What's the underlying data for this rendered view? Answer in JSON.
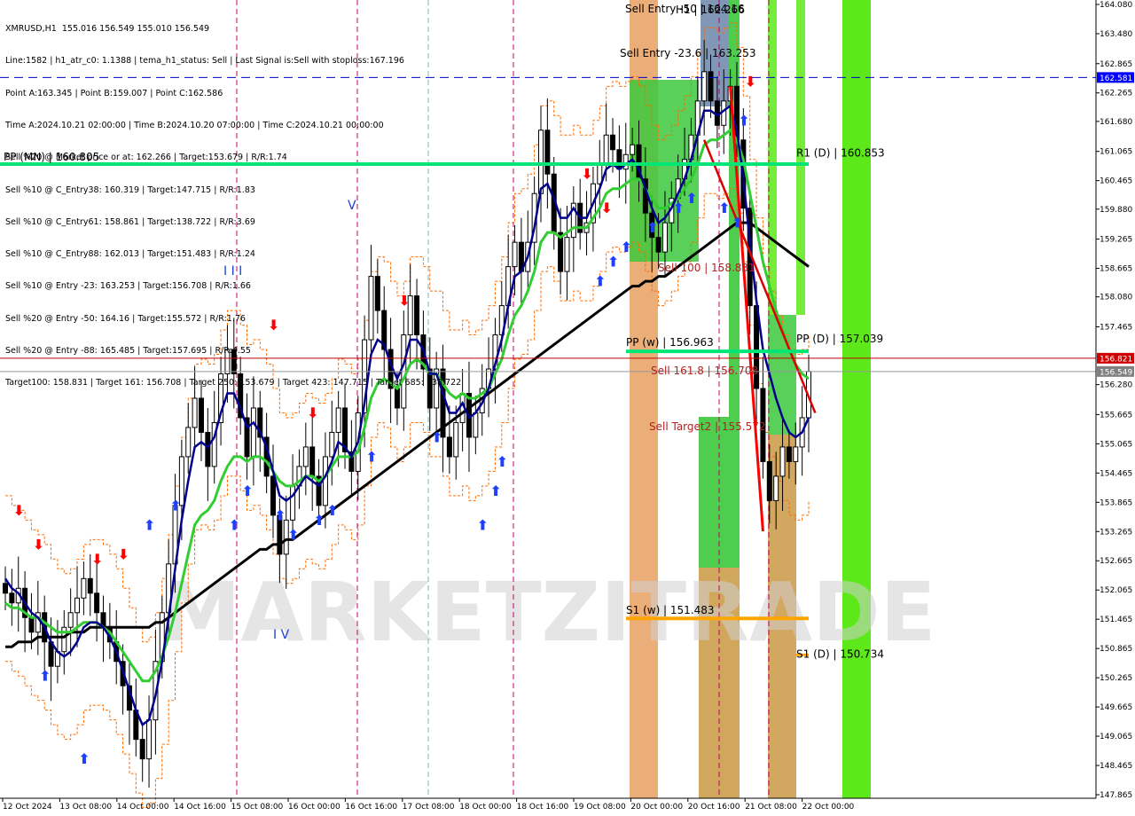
{
  "header": {
    "lines": [
      "XMRUSD,H1  155.016 156.549 155.010 156.549",
      "Line:1582 | h1_atr_c0: 1.1388 | tema_h1_status: Sell | Last Signal is:Sell with stoploss:167.196",
      "Point A:163.345 | Point B:159.007 | Point C:162.586",
      "Time A:2024.10.21 02:00:00 | Time B:2024.10.20 07:00:00 | Time C:2024.10.21 00:00:00",
      "Sell %20 @ Market price or at: 162.266 | Target:153.679 | R/R:1.74",
      "Sell %10 @ C_Entry38: 160.319 | Target:147.715 | R/R:1.83",
      "Sell %10 @ C_Entry61: 158.861 | Target:138.722 | R/R:3.69",
      "Sell %10 @ C_Entry88: 162.013 | Target:151.483 | R/R:1.24",
      "Sell %10 @ Entry -23: 163.253 | Target:156.708 | R/R:1.66",
      "Sell %20 @ Entry -50: 164.16 | Target:155.572 | R/R:1.76",
      "Sell %20 @ Entry -88: 165.485 | Target:157.695 | R/R:4.55",
      "Target100: 158.831 | Target 161: 156.708 | Target 250: 153.679 | Target 423: 147.715 | Target 685: 138.722"
    ]
  },
  "watermark": "MARKETZITRADE",
  "colors": {
    "candle": "#000000",
    "ema_blue": "#00008b",
    "ema_green": "#32cd32",
    "ma_black": "#000000",
    "orange_dash": "#ff6a00",
    "pivot_green": "#00e676",
    "price_red": "#c00000",
    "s1_orange": "#ffa500",
    "band_bright_green": "#5de81a",
    "band_green": "#3cc83c",
    "band_orange": "#e8a060",
    "band_steelblue": "#6a86a8",
    "up_arrow": "#1f3fff",
    "down_arrow": "#ff0000"
  },
  "chart_data": {
    "type": "candlestick",
    "symbol": "XMRUSD",
    "timeframe": "H1",
    "ohlc_last": {
      "open": 155.016,
      "high": 156.549,
      "low": 155.01,
      "close": 156.549
    },
    "ylim": [
      147.865,
      164.08
    ],
    "y_ticks": [
      "164.080",
      "163.480",
      "162.865",
      "162.265",
      "161.680",
      "161.065",
      "160.465",
      "159.880",
      "159.265",
      "158.665",
      "158.080",
      "157.465",
      "156.280",
      "155.665",
      "155.065",
      "154.465",
      "153.865",
      "153.265",
      "152.665",
      "152.065",
      "151.465",
      "150.865",
      "150.265",
      "149.665",
      "149.065",
      "148.465",
      "147.865"
    ],
    "x_ticks": [
      "12 Oct 2024",
      "13 Oct 08:00",
      "14 Oct 00:00",
      "14 Oct 16:00",
      "15 Oct 08:00",
      "16 Oct 00:00",
      "16 Oct 16:00",
      "17 Oct 08:00",
      "18 Oct 00:00",
      "18 Oct 16:00",
      "19 Oct 08:00",
      "20 Oct 00:00",
      "20 Oct 16:00",
      "21 Oct 08:00",
      "22 Oct 00:00"
    ],
    "price_badges": [
      {
        "value": "162.581",
        "bg": "#0000ff",
        "color": "#ffffff"
      },
      {
        "value": "156.821",
        "bg": "#d00000",
        "color": "#ffffff"
      },
      {
        "value": "156.549",
        "bg": "#808080",
        "color": "#ffffff"
      }
    ],
    "levels": [
      {
        "label": "PP (MN) | 160.805",
        "price": 160.805,
        "color": "#00e676"
      },
      {
        "label": "R1 (D) | 160.853",
        "price": 160.853
      },
      {
        "label": "PP (w) | 156.963",
        "price": 156.963,
        "color": "#00e676"
      },
      {
        "label": "PP (D) | 157.039",
        "price": 157.039
      },
      {
        "label": "S1 (w) | 151.483",
        "price": 151.483,
        "color": "#ffa500"
      },
      {
        "label": "S1 (D) | 150.734",
        "price": 150.734,
        "color": "#ffa500"
      },
      {
        "label": "Sell Entry -50 | 164.16",
        "price": 164.16
      },
      {
        "label": "Sell Entry -23.6 | 163.253",
        "price": 163.253
      },
      {
        "label": "Sell 100 | 158.831",
        "price": 158.831
      },
      {
        "label": "Sell 161.8 | 156.708",
        "price": 156.708
      },
      {
        "label": "Sell Target2 | 155.572",
        "price": 155.572
      },
      {
        "label": "H1 | 162.266",
        "price": 162.266
      }
    ],
    "wave_labels": [
      {
        "text": "I I I"
      },
      {
        "text": "V"
      },
      {
        "text": "I V"
      }
    ],
    "closes": [
      152.0,
      151.8,
      152.1,
      151.5,
      151.2,
      151.6,
      151.0,
      150.5,
      150.8,
      151.3,
      151.6,
      151.9,
      152.3,
      152.0,
      151.6,
      151.3,
      151.0,
      150.6,
      150.1,
      149.6,
      149.0,
      148.6,
      149.4,
      150.6,
      151.6,
      152.6,
      153.8,
      154.8,
      155.4,
      156.0,
      155.3,
      154.6,
      155.5,
      156.5,
      157.0,
      156.5,
      155.6,
      154.8,
      155.8,
      155.2,
      154.4,
      153.6,
      152.8,
      153.5,
      154.2,
      154.6,
      155.0,
      154.4,
      153.8,
      154.8,
      155.3,
      155.8,
      154.9,
      154.5,
      155.7,
      157.2,
      158.5,
      157.8,
      157.0,
      156.2,
      155.8,
      157.3,
      158.1,
      157.3,
      156.6,
      155.8,
      156.6,
      155.2,
      154.8,
      155.5,
      156.1,
      155.2,
      155.7,
      156.2,
      156.6,
      157.3,
      157.9,
      158.7,
      159.2,
      158.6,
      159.2,
      160.2,
      161.5,
      160.6,
      159.4,
      158.6,
      159.3,
      160.0,
      159.4,
      159.6,
      160.4,
      160.8,
      161.4,
      161.1,
      160.7,
      161.0,
      161.2,
      160.5,
      159.8,
      159.3,
      159.0,
      159.6,
      160.1,
      160.5,
      160.9,
      161.4,
      162.1,
      162.7,
      162.1,
      161.6,
      162.1,
      162.4,
      161.3,
      159.9,
      157.9,
      156.2,
      154.7,
      153.9,
      154.4,
      155.0,
      154.7,
      155.0,
      155.6,
      156.549
    ],
    "ema_blue": [
      152.3,
      152.1,
      152.0,
      151.8,
      151.6,
      151.5,
      151.3,
      151.0,
      150.8,
      150.7,
      150.8,
      151.0,
      151.3,
      151.4,
      151.4,
      151.3,
      151.1,
      150.8,
      150.4,
      150.0,
      149.6,
      149.3,
      149.4,
      149.9,
      150.6,
      151.5,
      152.5,
      153.5,
      154.3,
      155.0,
      155.1,
      155.0,
      155.2,
      155.7,
      156.1,
      156.1,
      155.8,
      155.4,
      155.5,
      155.3,
      155.0,
      154.5,
      154.0,
      153.9,
      154.0,
      154.2,
      154.4,
      154.3,
      154.2,
      154.4,
      154.7,
      155.1,
      155.0,
      154.8,
      155.1,
      155.9,
      156.9,
      157.2,
      157.1,
      156.7,
      156.4,
      156.7,
      157.2,
      157.2,
      157.0,
      156.5,
      156.5,
      156.1,
      155.7,
      155.7,
      155.9,
      155.6,
      155.7,
      155.9,
      156.2,
      156.7,
      157.2,
      157.9,
      158.5,
      158.6,
      158.9,
      159.5,
      160.3,
      160.4,
      160.1,
      159.7,
      159.7,
      159.9,
      159.7,
      159.7,
      160.0,
      160.3,
      160.7,
      160.8,
      160.7,
      160.8,
      160.9,
      160.7,
      160.3,
      159.9,
      159.6,
      159.7,
      159.9,
      160.2,
      160.5,
      160.9,
      161.4,
      161.9,
      161.9,
      161.8,
      161.9,
      162.0,
      161.5,
      160.5,
      159.2,
      158.0,
      157.0,
      156.5,
      156.0,
      155.6,
      155.3,
      155.2,
      155.3,
      155.6
    ],
    "ema_green": [
      151.8,
      151.7,
      151.7,
      151.6,
      151.5,
      151.5,
      151.4,
      151.3,
      151.2,
      151.2,
      151.2,
      151.3,
      151.4,
      151.4,
      151.4,
      151.3,
      151.2,
      151.0,
      150.8,
      150.6,
      150.4,
      150.2,
      150.2,
      150.4,
      150.7,
      151.1,
      151.6,
      152.2,
      152.8,
      153.4,
      153.6,
      153.7,
      153.9,
      154.3,
      154.6,
      154.8,
      154.8,
      154.7,
      154.8,
      154.8,
      154.7,
      154.5,
      154.3,
      154.2,
      154.2,
      154.3,
      154.4,
      154.4,
      154.3,
      154.4,
      154.6,
      154.8,
      154.8,
      154.8,
      154.9,
      155.4,
      156.0,
      156.3,
      156.4,
      156.3,
      156.2,
      156.4,
      156.7,
      156.8,
      156.7,
      156.5,
      156.5,
      156.3,
      156.1,
      156.0,
      156.1,
      156.0,
      156.0,
      156.1,
      156.2,
      156.5,
      156.8,
      157.3,
      157.7,
      157.9,
      158.2,
      158.6,
      159.2,
      159.4,
      159.4,
      159.3,
      159.4,
      159.5,
      159.5,
      159.5,
      159.7,
      159.9,
      160.2,
      160.3,
      160.3,
      160.4,
      160.5,
      160.5,
      160.3,
      160.1,
      159.9,
      159.9,
      160.0,
      160.1,
      160.3,
      160.5,
      160.8,
      161.2,
      161.3,
      161.3,
      161.4,
      161.5,
      161.3,
      160.9,
      160.2,
      159.5,
      158.8,
      158.3,
      157.8,
      157.4,
      157.0,
      156.7,
      156.5,
      156.4
    ],
    "ma_black": [
      150.9,
      150.9,
      151.0,
      151.0,
      151.0,
      151.1,
      151.1,
      151.1,
      151.1,
      151.1,
      151.2,
      151.2,
      151.2,
      151.3,
      151.3,
      151.3,
      151.3,
      151.3,
      151.3,
      151.3,
      151.3,
      151.3,
      151.3,
      151.4,
      151.4,
      151.5,
      151.6,
      151.7,
      151.8,
      151.9,
      152.0,
      152.1,
      152.2,
      152.3,
      152.4,
      152.5,
      152.6,
      152.7,
      152.8,
      152.9,
      152.9,
      153.0,
      153.0,
      153.1,
      153.1,
      153.2,
      153.3,
      153.4,
      153.5,
      153.6,
      153.7,
      153.8,
      153.9,
      154.0,
      154.1,
      154.2,
      154.3,
      154.4,
      154.5,
      154.6,
      154.7,
      154.8,
      154.9,
      155.0,
      155.1,
      155.2,
      155.3,
      155.4,
      155.5,
      155.6,
      155.7,
      155.8,
      155.9,
      156.0,
      156.1,
      156.2,
      156.3,
      156.4,
      156.5,
      156.6,
      156.7,
      156.8,
      156.9,
      157.0,
      157.1,
      157.2,
      157.3,
      157.4,
      157.5,
      157.6,
      157.7,
      157.8,
      157.9,
      158.0,
      158.1,
      158.2,
      158.3,
      158.3,
      158.4,
      158.4,
      158.5,
      158.5,
      158.6,
      158.7,
      158.8,
      158.9,
      159.0,
      159.1,
      159.2,
      159.3,
      159.4,
      159.5,
      159.6,
      159.6,
      159.6,
      159.5,
      159.4,
      159.3,
      159.2,
      159.1,
      159.0,
      158.9,
      158.8,
      158.7
    ]
  }
}
